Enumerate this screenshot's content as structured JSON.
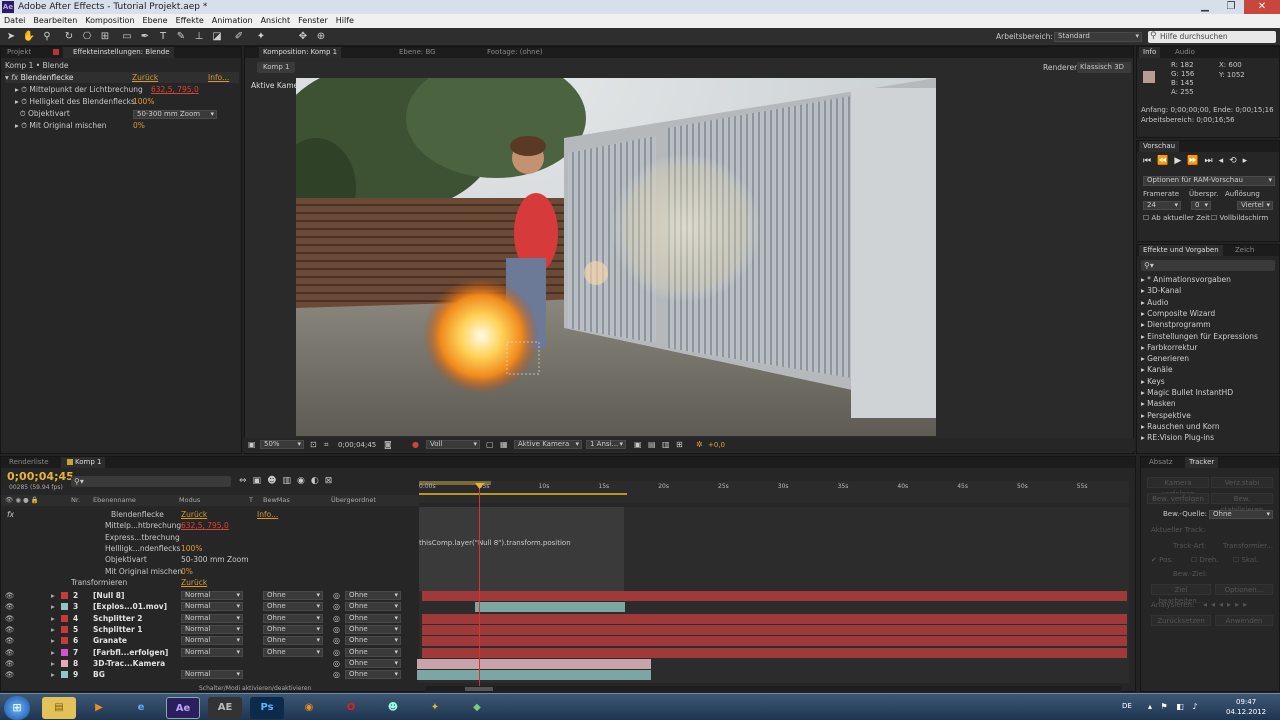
{
  "window": {
    "title": "Adobe After Effects - Tutorial Projekt.aep *",
    "app_icon": "Ae"
  },
  "menu": [
    "Datei",
    "Bearbeiten",
    "Komposition",
    "Ebene",
    "Effekte",
    "Animation",
    "Ansicht",
    "Fenster",
    "Hilfe"
  ],
  "toolbar": {
    "workspace_label": "Arbeitsbereich:",
    "workspace_value": "Standard",
    "help_placeholder": "Hilfe durchsuchen"
  },
  "effects_panel": {
    "tab_project": "Projekt",
    "tab_effects": "Effekteinstellungen: Blende",
    "breadcrumb": "Komp 1 • Blende",
    "effect_name": "Blendenflecke",
    "reset": "Zurück",
    "info": "Info...",
    "props": [
      {
        "label": "Mittelpunkt der Lichtbrechung",
        "value": "632,5, 795,0"
      },
      {
        "label": "Helligkeit des Blendenflecks",
        "value": "100%"
      },
      {
        "label": "Objektivart",
        "value": "50-300 mm Zoom"
      },
      {
        "label": "Mit Original mischen",
        "value": "0%"
      }
    ]
  },
  "comp_panel": {
    "tab_comp": "Komposition: Komp 1",
    "tab_layer": "Ebene: BG",
    "tab_footage": "Footage: (ohne)",
    "comp_tab": "Komp 1",
    "renderer_label": "Renderer:",
    "renderer_value": "Klassisch 3D",
    "camera_label": "Aktive Kamera",
    "zoom": "50%",
    "timecode": "0;00;04;45",
    "resolution": "Voll",
    "camera_select": "Aktive Kamera",
    "views": "1 Ansi...",
    "exposure": "+0,0"
  },
  "info_panel": {
    "tab_info": "Info",
    "tab_audio": "Audio",
    "r": "R: 182",
    "g": "G: 156",
    "b": "B: 145",
    "a": "A: 255",
    "x": "X: 600",
    "y": "Y: 1052",
    "start_end": "Anfang: 0;00;00;00, Ende: 0;00;15;16",
    "work_area": "Arbeitsbereich: 0;00;16;56",
    "swatch_color": "#b69c91"
  },
  "preview_panel": {
    "tab": "Vorschau",
    "ram_options": "Optionen für RAM-Vorschau",
    "framerate_label": "Framerate",
    "skip_label": "Überspr.",
    "resolution_label": "Auflösung",
    "framerate": "24",
    "skip": "0",
    "resolution": "Viertel",
    "from_current": "Ab aktueller Zeit",
    "fullscreen": "Vollbildschirm"
  },
  "presets_panel": {
    "tab": "Effekte und Vorgaben",
    "tab2": "Zeich",
    "items": [
      "* Animationsvorgaben",
      "3D-Kanal",
      "Audio",
      "Composite Wizard",
      "Dienstprogramm",
      "Einstellungen für Expressions",
      "Farbkorrektur",
      "Generieren",
      "Kanäle",
      "Keys",
      "Magic Bullet InstantHD",
      "Masken",
      "Perspektive",
      "Rauschen und Korn",
      "RE:Vision Plug-ins"
    ]
  },
  "tracker_panel": {
    "tab_paragraph": "Absatz",
    "tab_tracker": "Tracker",
    "btn_track_camera": "Kamera verfolgen",
    "btn_warp_stabilizer": "Verz.stabi",
    "btn_track_motion": "Bew. verfolgen",
    "btn_stabilize": "Bew. stabilisieren",
    "source_label": "Bew.-Quelle:",
    "source_value": "Ohne",
    "current_track": "Aktueller Track:",
    "track_type": "Track-Art:",
    "track_type_value": "Transformier...",
    "pos": "Pos.",
    "rot": "Dreh.",
    "scale": "Skal.",
    "motion_target": "Bew.-Ziel:",
    "edit_target": "Ziel bearbeiten...",
    "options": "Optionen...",
    "analyze": "Analysieren:",
    "reset": "Zurücksetzen",
    "apply": "Anwenden"
  },
  "timeline": {
    "tab_render": "Renderliste",
    "tab_comp": "Komp 1",
    "timecode": "0;00;04;45",
    "frames": "00285 (59.94 fps)",
    "col_nr": "Nr.",
    "col_name": "Ebenenname",
    "col_mode": "Modus",
    "col_t": "T",
    "col_trkmat": "BewMas",
    "col_parent": "Übergeordnet",
    "ruler": [
      "0:00s",
      "05s",
      "10s",
      "15s",
      "20s",
      "25s",
      "30s",
      "35s",
      "40s",
      "45s",
      "50s",
      "55s"
    ],
    "effect_rows": [
      {
        "label": "Blendenflecke",
        "value": "Zurück",
        "extra": "Info..."
      },
      {
        "label": "Mittelp...htbrechung",
        "value": "632,5, 795,0"
      },
      {
        "label": "Express...tbrechung",
        "value": ""
      },
      {
        "label": "Hellligk...ndenflecks",
        "value": "100%"
      },
      {
        "label": "Objektivart",
        "value": "50-300 mm Zoom"
      },
      {
        "label": "Mit Original mischen",
        "value": "0%"
      },
      {
        "label": "Transformieren",
        "value": "Zurück"
      }
    ],
    "expression": "thisComp.layer(\"Null 8\").transform.position",
    "layers": [
      {
        "nr": "2",
        "name": "[Null 8]",
        "mode": "Normal",
        "trkmat": "Ohne",
        "parent": "Ohne",
        "color": "#c83a3a"
      },
      {
        "nr": "3",
        "name": "[Explos...01.mov]",
        "mode": "Normal",
        "trkmat": "Ohne",
        "parent": "Ohne",
        "color": "#8fc7c7"
      },
      {
        "nr": "4",
        "name": "Schplitter 2",
        "mode": "Normal",
        "trkmat": "Ohne",
        "parent": "Ohne",
        "color": "#c83a3a"
      },
      {
        "nr": "5",
        "name": "Schplitter 1",
        "mode": "Normal",
        "trkmat": "Ohne",
        "parent": "Ohne",
        "color": "#c83a3a"
      },
      {
        "nr": "6",
        "name": "Granate",
        "mode": "Normal",
        "trkmat": "Ohne",
        "parent": "Ohne",
        "color": "#c83a3a"
      },
      {
        "nr": "7",
        "name": "[Farbfl...erfolgen]",
        "mode": "Normal",
        "trkmat": "Ohne",
        "parent": "Ohne",
        "color": "#d94fd0"
      },
      {
        "nr": "8",
        "name": "3D-Trac...Kamera",
        "mode": "",
        "trkmat": "",
        "parent": "Ohne",
        "color": "#e6a7b8"
      },
      {
        "nr": "9",
        "name": "BG",
        "mode": "Normal",
        "trkmat": "",
        "parent": "Ohne",
        "color": "#8fc7c7"
      }
    ],
    "footer": "Schalter/Modi aktivieren/deaktivieren"
  },
  "taskbar": {
    "lang": "DE",
    "time": "09:47",
    "date": "04.12.2012"
  }
}
